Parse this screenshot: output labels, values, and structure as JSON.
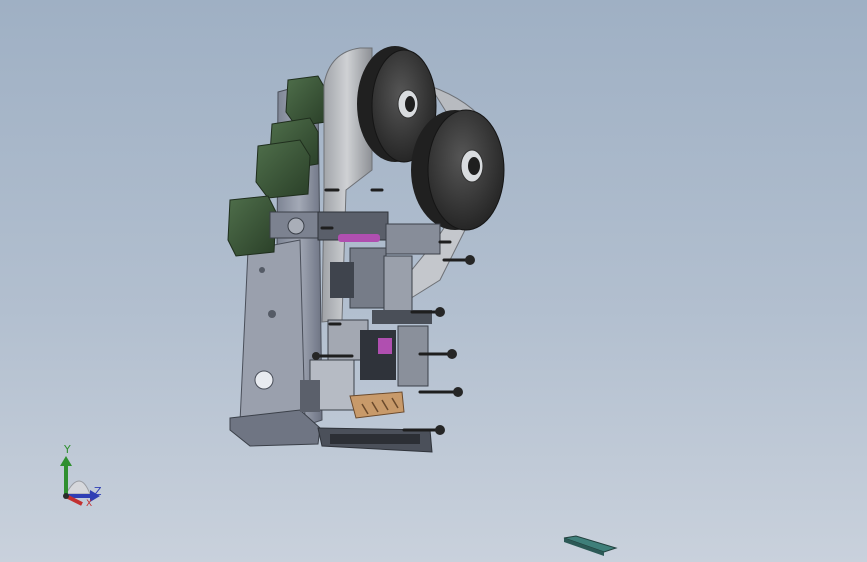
{
  "viewport": {
    "background_top": "#9fb0c4",
    "background_bottom": "#c9d1dc"
  },
  "triad": {
    "x_label": "X",
    "y_label": "Y",
    "z_label": "Z",
    "x_color": "#c23030",
    "y_color": "#2f8f2f",
    "z_color": "#2f3fb5"
  },
  "model": {
    "frame_color": "#8f96a6",
    "motor_color": "#3d5a3a",
    "reel_color": "#3a3a3a",
    "accent_color": "#b04fb0",
    "wood_color": "#c89a6a",
    "part_color": "#3f7f7a"
  }
}
